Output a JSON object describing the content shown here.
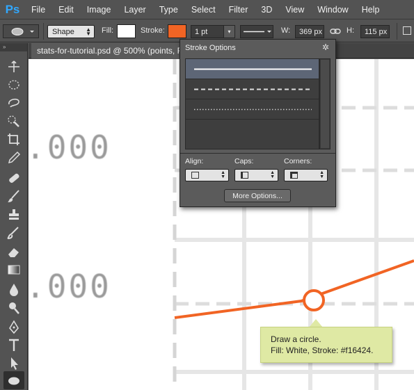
{
  "app": {
    "logo": "Ps",
    "menu": [
      "File",
      "Edit",
      "Image",
      "Layer",
      "Type",
      "Select",
      "Filter",
      "3D",
      "View",
      "Window",
      "Help"
    ]
  },
  "options_bar": {
    "tool_mode": "Shape",
    "fill_label": "Fill:",
    "fill_color": "#ffffff",
    "stroke_label": "Stroke:",
    "stroke_color": "#f16424",
    "stroke_width": "1 pt",
    "w_label": "W:",
    "width_value": "369 px",
    "h_label": "H:",
    "height_value": "115 px"
  },
  "tools": {
    "header": "»",
    "items": [
      "move-tool",
      "elliptical-marquee-tool",
      "lasso-tool",
      "quick-selection-tool",
      "crop-tool",
      "eyedropper-tool",
      "spot-healing-tool",
      "brush-tool",
      "clone-stamp-tool",
      "history-brush-tool",
      "eraser-tool",
      "gradient-tool",
      "blur-tool",
      "dodge-tool",
      "pen-tool",
      "type-tool",
      "path-selection-tool",
      "ellipse-tool"
    ]
  },
  "document": {
    "tab_title": "stats-for-tutorial.psd @ 500% (points, RG"
  },
  "canvas": {
    "labels": [
      ".000",
      ".000"
    ],
    "accent_color": "#f16424"
  },
  "stroke_popup": {
    "title": "Stroke Options",
    "stroke_types": [
      "solid",
      "dashed",
      "dotted"
    ],
    "align_label": "Align:",
    "caps_label": "Caps:",
    "corners_label": "Corners:",
    "more_button": "More Options..."
  },
  "tooltip": {
    "line1": "Draw a circle.",
    "line2": "Fill: White, Stroke: #f16424."
  }
}
